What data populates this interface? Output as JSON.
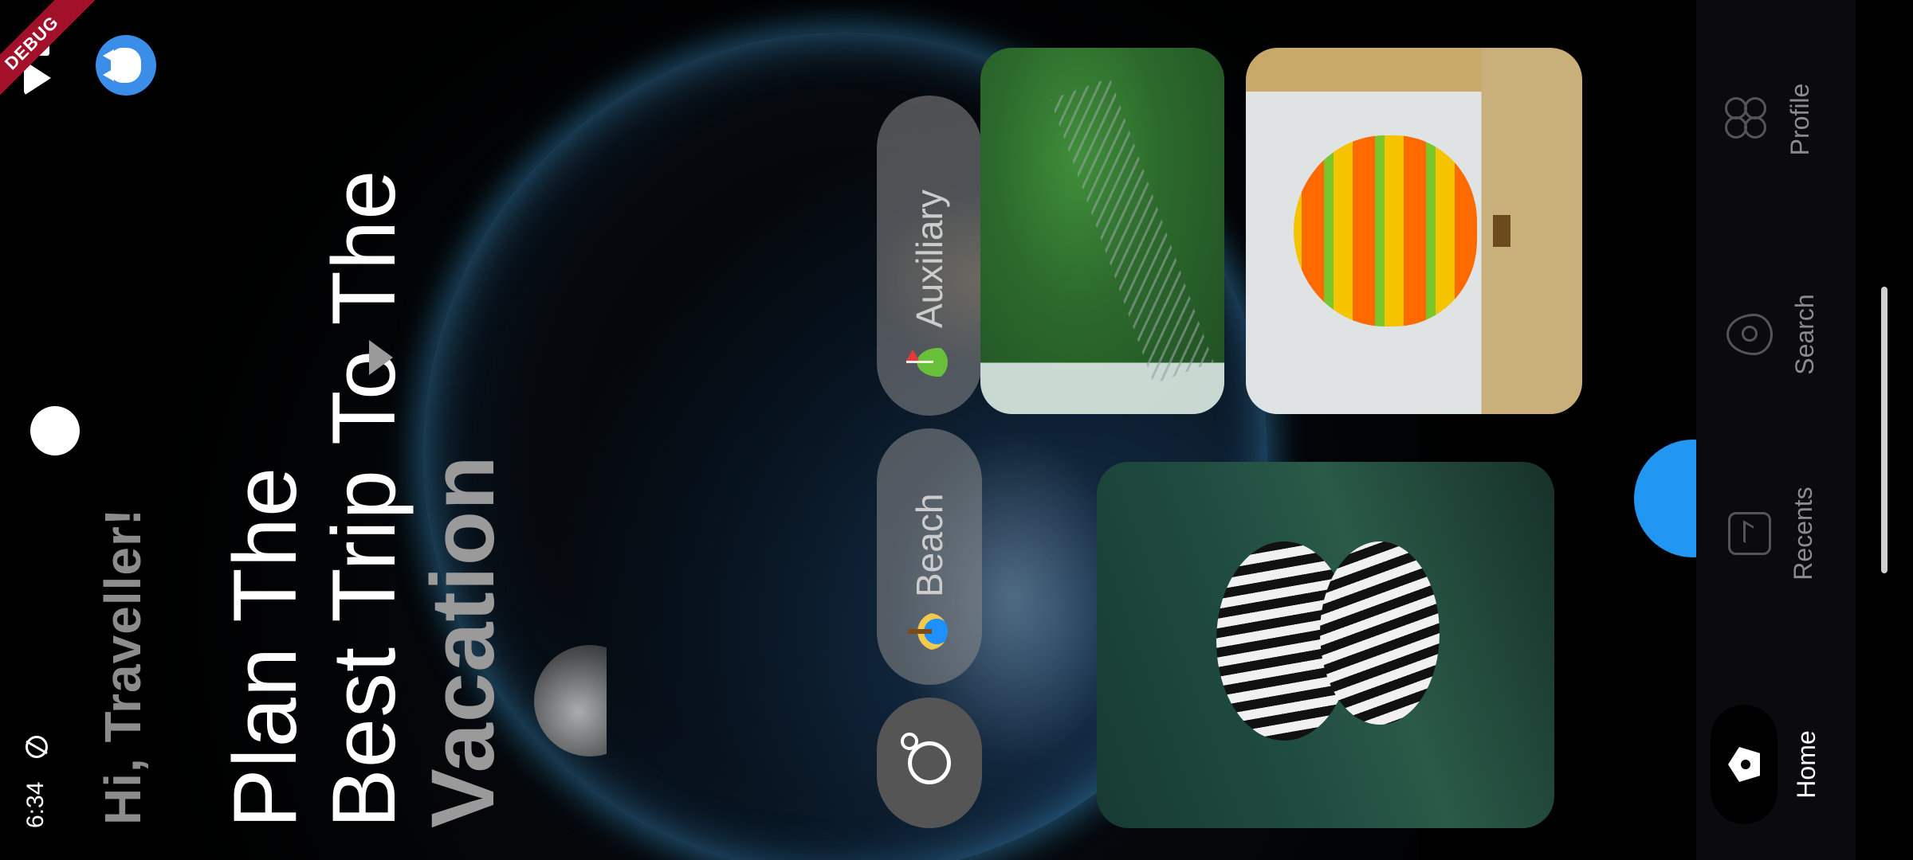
{
  "status_bar": {
    "time": "6:34",
    "debug_label": "DEBUG"
  },
  "header": {
    "greeting": "Hi, Traveller!",
    "headline_lines": [
      "Plan The",
      "Best Trip To The"
    ],
    "headline_emphasis": "Vacation"
  },
  "chips": [
    {
      "icon": "search-icon"
    },
    {
      "icon": "beach-emoji",
      "label": "Beach"
    },
    {
      "icon": "golf-emoji",
      "label": "Auxiliary"
    }
  ],
  "photos": [
    {
      "icon": "zebra-photo"
    },
    {
      "icon": "forest-photo"
    },
    {
      "icon": "hot-air-balloon-photo"
    }
  ],
  "bottom_nav": {
    "items": [
      {
        "label": "Home",
        "icon": "home-icon",
        "active": true
      },
      {
        "label": "Recents",
        "icon": "recents-icon"
      },
      {
        "label": "Search",
        "icon": "location-pin-icon"
      },
      {
        "label": "Profile",
        "icon": "profile-icon"
      }
    ]
  },
  "colors": {
    "accent": "#2196f3",
    "avatar": "#3a8de8",
    "debug_ribbon": "#a2102a",
    "muted_text": "#9a9a9a"
  }
}
